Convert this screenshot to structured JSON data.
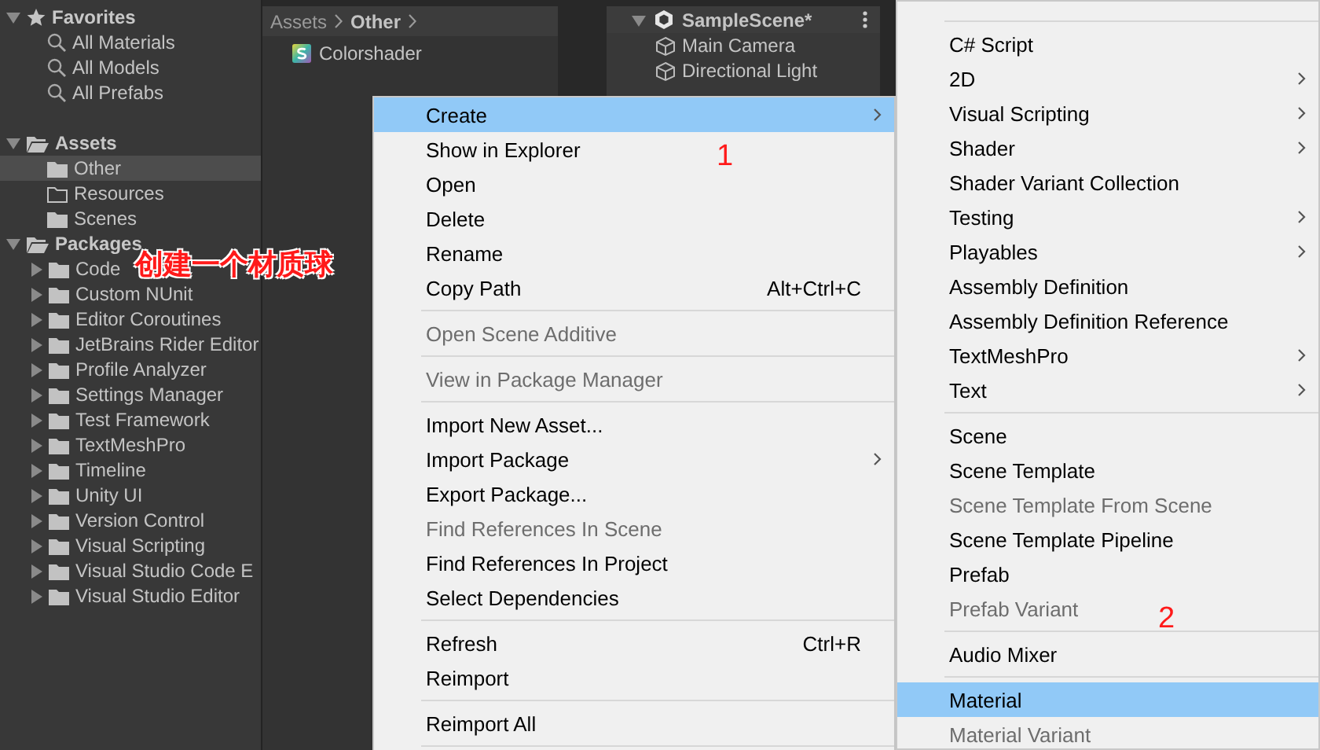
{
  "sidebar": {
    "sections": [
      {
        "label": "Favorites",
        "kind": "favorites",
        "expanded": true,
        "children": [
          {
            "label": "All Materials",
            "kind": "search",
            "selected": false
          },
          {
            "label": "All Models",
            "kind": "search",
            "selected": false
          },
          {
            "label": "All Prefabs",
            "kind": "search",
            "selected": false
          }
        ]
      },
      {
        "label": "Assets",
        "kind": "folder",
        "expanded": true,
        "children": [
          {
            "label": "Other",
            "kind": "folder",
            "selected": true
          },
          {
            "label": "Resources",
            "kind": "empty-folder",
            "selected": false
          },
          {
            "label": "Scenes",
            "kind": "folder",
            "selected": false
          }
        ]
      },
      {
        "label": "Packages",
        "kind": "folder",
        "expanded": true,
        "children": [
          {
            "label": "Code",
            "kind": "package",
            "expanded": false,
            "selected": false
          },
          {
            "label": "Custom NUnit",
            "kind": "package",
            "expanded": false,
            "selected": false
          },
          {
            "label": "Editor Coroutines",
            "kind": "package",
            "expanded": false,
            "selected": false
          },
          {
            "label": "JetBrains Rider Editor",
            "kind": "package",
            "expanded": false,
            "selected": false
          },
          {
            "label": "Profile Analyzer",
            "kind": "package",
            "expanded": false,
            "selected": false
          },
          {
            "label": "Settings Manager",
            "kind": "package",
            "expanded": false,
            "selected": false
          },
          {
            "label": "Test Framework",
            "kind": "package",
            "expanded": false,
            "selected": false
          },
          {
            "label": "TextMeshPro",
            "kind": "package",
            "expanded": false,
            "selected": false
          },
          {
            "label": "Timeline",
            "kind": "package",
            "expanded": false,
            "selected": false
          },
          {
            "label": "Unity UI",
            "kind": "package",
            "expanded": false,
            "selected": false
          },
          {
            "label": "Version Control",
            "kind": "package",
            "expanded": false,
            "selected": false
          },
          {
            "label": "Visual Scripting",
            "kind": "package",
            "expanded": false,
            "selected": false
          },
          {
            "label": "Visual Studio Code E",
            "kind": "package",
            "expanded": false,
            "selected": false
          },
          {
            "label": "Visual Studio Editor",
            "kind": "package",
            "expanded": false,
            "selected": false
          }
        ]
      }
    ]
  },
  "project": {
    "breadcrumb": [
      {
        "label": "Assets",
        "current": false
      },
      {
        "label": "Other",
        "current": true
      }
    ],
    "files": [
      {
        "label": "Colorshader",
        "kind": "shader"
      }
    ]
  },
  "hierarchy": {
    "scene": "SampleScene*",
    "expanded": true,
    "objects": [
      "Main Camera",
      "Directional Light"
    ]
  },
  "context_menu": {
    "items": [
      {
        "kind": "item",
        "label": "Create",
        "selected": true,
        "disabled": false,
        "submenu": true
      },
      {
        "kind": "item",
        "label": "Show in Explorer",
        "selected": false,
        "disabled": false,
        "submenu": false
      },
      {
        "kind": "item",
        "label": "Open",
        "selected": false,
        "disabled": false,
        "submenu": false
      },
      {
        "kind": "item",
        "label": "Delete",
        "selected": false,
        "disabled": false,
        "submenu": false
      },
      {
        "kind": "item",
        "label": "Rename",
        "selected": false,
        "disabled": false,
        "submenu": false
      },
      {
        "kind": "item",
        "label": "Copy Path",
        "shortcut": "Alt+Ctrl+C",
        "selected": false,
        "disabled": false,
        "submenu": false
      },
      {
        "kind": "separator"
      },
      {
        "kind": "item",
        "label": "Open Scene Additive",
        "selected": false,
        "disabled": true,
        "submenu": false
      },
      {
        "kind": "separator"
      },
      {
        "kind": "item",
        "label": "View in Package Manager",
        "selected": false,
        "disabled": true,
        "submenu": false
      },
      {
        "kind": "separator"
      },
      {
        "kind": "item",
        "label": "Import New Asset...",
        "selected": false,
        "disabled": false,
        "submenu": false
      },
      {
        "kind": "item",
        "label": "Import Package",
        "selected": false,
        "disabled": false,
        "submenu": true
      },
      {
        "kind": "item",
        "label": "Export Package...",
        "selected": false,
        "disabled": false,
        "submenu": false
      },
      {
        "kind": "item",
        "label": "Find References In Scene",
        "selected": false,
        "disabled": true,
        "submenu": false
      },
      {
        "kind": "item",
        "label": "Find References In Project",
        "selected": false,
        "disabled": false,
        "submenu": false
      },
      {
        "kind": "item",
        "label": "Select Dependencies",
        "selected": false,
        "disabled": false,
        "submenu": false
      },
      {
        "kind": "separator"
      },
      {
        "kind": "item",
        "label": "Refresh",
        "shortcut": "Ctrl+R",
        "selected": false,
        "disabled": false,
        "submenu": false
      },
      {
        "kind": "item",
        "label": "Reimport",
        "selected": false,
        "disabled": false,
        "submenu": false
      },
      {
        "kind": "separator"
      },
      {
        "kind": "item",
        "label": "Reimport All",
        "selected": false,
        "disabled": false,
        "submenu": false
      },
      {
        "kind": "separator"
      }
    ]
  },
  "create_submenu": {
    "items": [
      {
        "kind": "separator"
      },
      {
        "kind": "item",
        "label": "C# Script",
        "selected": false,
        "disabled": false,
        "submenu": false
      },
      {
        "kind": "item",
        "label": "2D",
        "selected": false,
        "disabled": false,
        "submenu": true
      },
      {
        "kind": "item",
        "label": "Visual Scripting",
        "selected": false,
        "disabled": false,
        "submenu": true
      },
      {
        "kind": "item",
        "label": "Shader",
        "selected": false,
        "disabled": false,
        "submenu": true
      },
      {
        "kind": "item",
        "label": "Shader Variant Collection",
        "selected": false,
        "disabled": false,
        "submenu": false
      },
      {
        "kind": "item",
        "label": "Testing",
        "selected": false,
        "disabled": false,
        "submenu": true
      },
      {
        "kind": "item",
        "label": "Playables",
        "selected": false,
        "disabled": false,
        "submenu": true
      },
      {
        "kind": "item",
        "label": "Assembly Definition",
        "selected": false,
        "disabled": false,
        "submenu": false
      },
      {
        "kind": "item",
        "label": "Assembly Definition Reference",
        "selected": false,
        "disabled": false,
        "submenu": false
      },
      {
        "kind": "item",
        "label": "TextMeshPro",
        "selected": false,
        "disabled": false,
        "submenu": true
      },
      {
        "kind": "item",
        "label": "Text",
        "selected": false,
        "disabled": false,
        "submenu": true
      },
      {
        "kind": "separator"
      },
      {
        "kind": "item",
        "label": "Scene",
        "selected": false,
        "disabled": false,
        "submenu": false
      },
      {
        "kind": "item",
        "label": "Scene Template",
        "selected": false,
        "disabled": false,
        "submenu": false
      },
      {
        "kind": "item",
        "label": "Scene Template From Scene",
        "selected": false,
        "disabled": true,
        "submenu": false
      },
      {
        "kind": "item",
        "label": "Scene Template Pipeline",
        "selected": false,
        "disabled": false,
        "submenu": false
      },
      {
        "kind": "item",
        "label": "Prefab",
        "selected": false,
        "disabled": false,
        "submenu": false
      },
      {
        "kind": "item",
        "label": "Prefab Variant",
        "selected": false,
        "disabled": true,
        "submenu": false
      },
      {
        "kind": "separator"
      },
      {
        "kind": "item",
        "label": "Audio Mixer",
        "selected": false,
        "disabled": false,
        "submenu": false
      },
      {
        "kind": "separator"
      },
      {
        "kind": "item",
        "label": "Material",
        "selected": true,
        "disabled": false,
        "submenu": false
      },
      {
        "kind": "item",
        "label": "Material Variant",
        "selected": false,
        "disabled": true,
        "submenu": false
      }
    ]
  },
  "annotations": [
    {
      "text": "创建一个材质球",
      "kind": "note"
    },
    {
      "text": "1",
      "kind": "step"
    },
    {
      "text": "2",
      "kind": "step"
    }
  ]
}
